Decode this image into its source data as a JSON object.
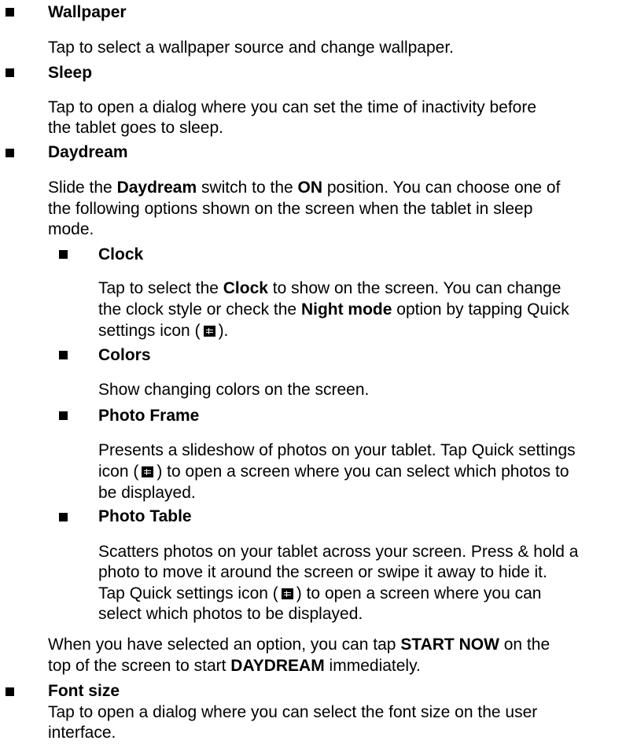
{
  "sections": {
    "wallpaper": {
      "title": "Wallpaper",
      "desc": "Tap to select a wallpaper source and change wallpaper."
    },
    "sleep": {
      "title": "Sleep",
      "desc_line1": "Tap to open a dialog where you can set the time of inactivity before",
      "desc_line2": "the tablet goes to sleep."
    },
    "daydream": {
      "title": "Daydream",
      "l1_a": "Slide the ",
      "l1_b": "Daydream",
      "l1_c": " switch to the ",
      "l1_d": "ON",
      "l1_e": " position. You can choose one of",
      "line2": "the following options shown on the screen when the tablet in sleep",
      "line3": "mode.",
      "clock": {
        "title": "Clock",
        "l1_a": "Tap to select the ",
        "l1_b": "Clock",
        "l1_c": " to show on the screen. You can change",
        "l2_a": "the clock style or check the ",
        "l2_b": "Night mode",
        "l2_c": " option by tapping Quick",
        "l3_a": "settings icon (",
        "l3_b": ")."
      },
      "colors": {
        "title": "Colors",
        "desc": "Show changing colors on the screen."
      },
      "photo_frame": {
        "title": "Photo Frame",
        "line1": "Presents a slideshow of photos on your tablet. Tap Quick settings",
        "l2_a": "icon (",
        "l2_b": ") to open a screen where you can select which photos to",
        "line3": "be displayed."
      },
      "photo_table": {
        "title": "Photo Table",
        "line1": "Scatters photos on your tablet across your screen. Press & hold a",
        "line2": "photo to move it around the screen or swipe it away to hide it.",
        "l3_a": "Tap Quick settings icon (",
        "l3_b": ") to open a screen where you can",
        "line4": "select which photos to be displayed."
      },
      "after": {
        "l1_a": "When you have selected an option, you can tap ",
        "l1_b": "START NOW",
        "l1_c": " on the",
        "l2_a": "top of the screen to start ",
        "l2_b": "DAYDREAM",
        "l2_c": " immediately."
      }
    },
    "font_size": {
      "title": "Font size",
      "desc_line1": "Tap to open a dialog where you can select the font size on the user",
      "desc_line2": "interface."
    }
  },
  "icons": {
    "bullet": "square-bullet-icon",
    "quick_settings": "quick-settings-icon"
  }
}
